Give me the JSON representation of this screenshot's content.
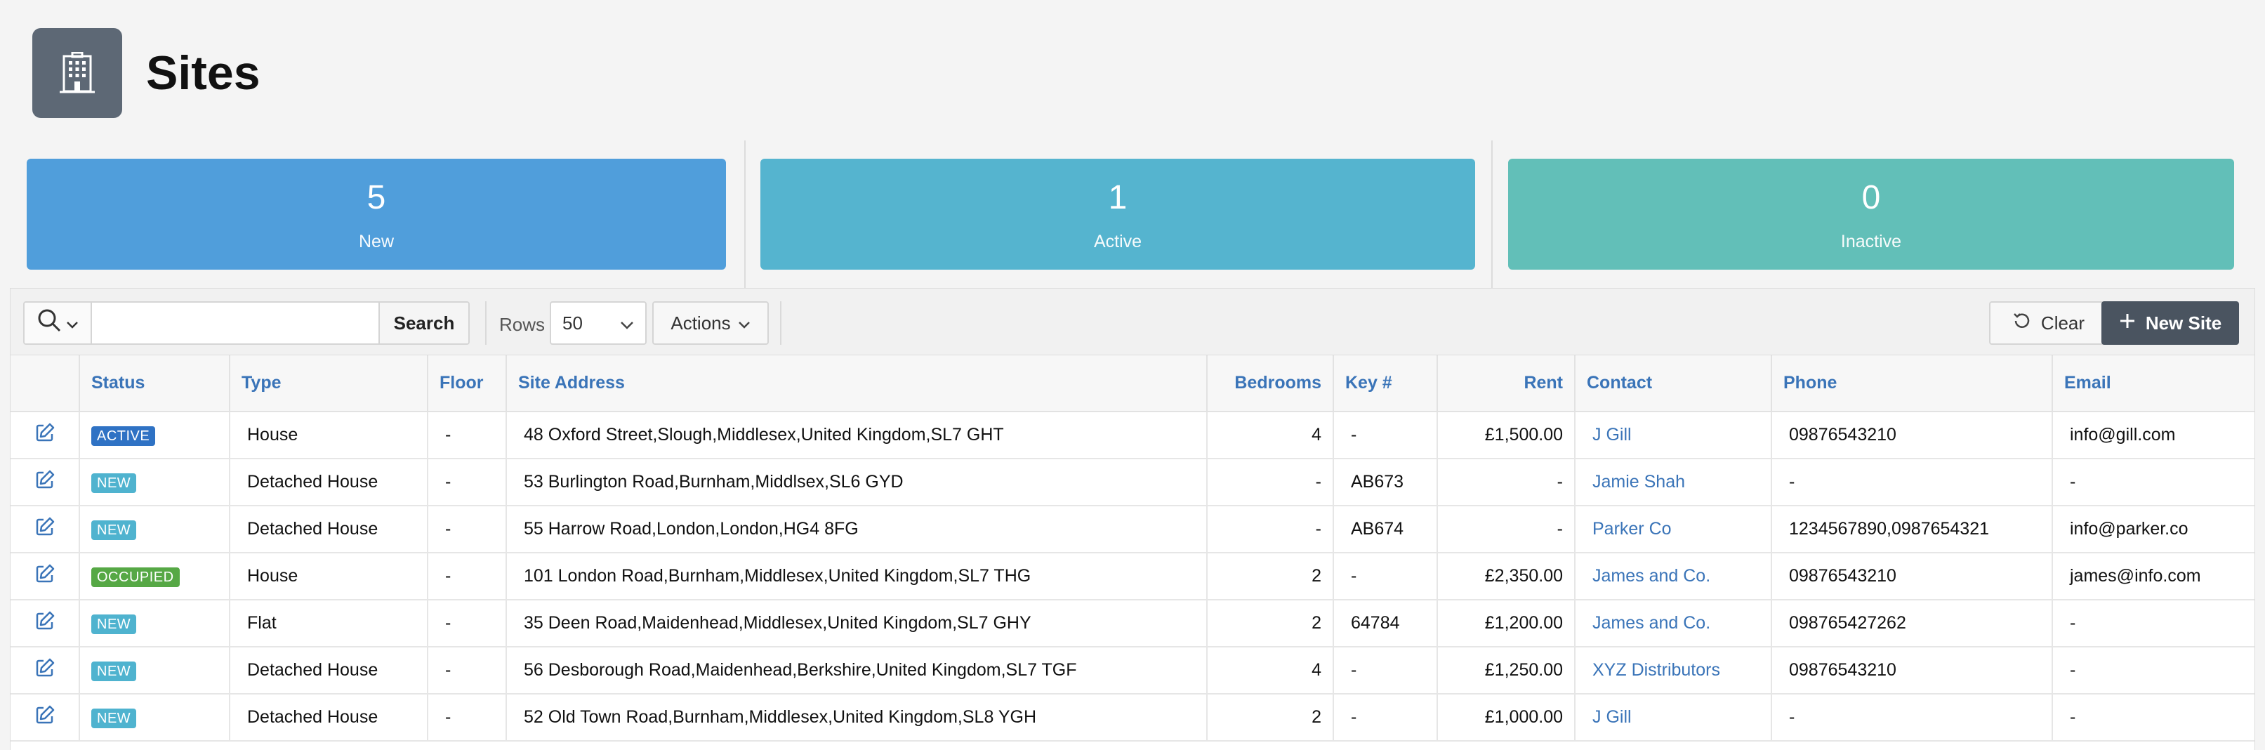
{
  "page": {
    "title": "Sites",
    "icon": "building-icon"
  },
  "stats": [
    {
      "value": "5",
      "label": "New",
      "color": "#509edb"
    },
    {
      "value": "1",
      "label": "Active",
      "color": "#55b4cf"
    },
    {
      "value": "0",
      "label": "Inactive",
      "color": "#62bfb8"
    }
  ],
  "toolbar": {
    "search_value": "",
    "search_label": "Search",
    "rows_label": "Rows",
    "rows_value": "50",
    "actions_label": "Actions",
    "clear_label": "Clear",
    "new_label": "New Site"
  },
  "table": {
    "headers": {
      "status": "Status",
      "type": "Type",
      "floor": "Floor",
      "address": "Site Address",
      "bedrooms": "Bedrooms",
      "key": "Key #",
      "rent": "Rent",
      "contact": "Contact",
      "phone": "Phone",
      "email": "Email"
    },
    "status_colors": {
      "ACTIVE": "#2f72c4",
      "NEW": "#4fb3cf",
      "OCCUPIED": "#56a845"
    },
    "rows": [
      {
        "status": "ACTIVE",
        "type": "House",
        "floor": "-",
        "address": "48 Oxford Street,Slough,Middlesex,United Kingdom,SL7 GHT",
        "bedrooms": "4",
        "key": "-",
        "rent": "£1,500.00",
        "contact": "J Gill",
        "phone": "09876543210",
        "email": "info@gill.com"
      },
      {
        "status": "NEW",
        "type": "Detached House",
        "floor": "-",
        "address": "53 Burlington Road,Burnham,Middlsex,SL6 GYD",
        "bedrooms": "-",
        "key": "AB673",
        "rent": "-",
        "contact": "Jamie Shah",
        "phone": "-",
        "email": "-"
      },
      {
        "status": "NEW",
        "type": "Detached House",
        "floor": "-",
        "address": "55 Harrow Road,London,London,HG4 8FG",
        "bedrooms": "-",
        "key": "AB674",
        "rent": "-",
        "contact": "Parker Co",
        "phone": "1234567890,0987654321",
        "email": "info@parker.co"
      },
      {
        "status": "OCCUPIED",
        "type": "House",
        "floor": "-",
        "address": "101 London Road,Burnham,Middlesex,United Kingdom,SL7 THG",
        "bedrooms": "2",
        "key": "-",
        "rent": "£2,350.00",
        "contact": "James and Co.",
        "phone": "09876543210",
        "email": "james@info.com"
      },
      {
        "status": "NEW",
        "type": "Flat",
        "floor": "-",
        "address": "35 Deen Road,Maidenhead,Middlesex,United Kingdom,SL7 GHY",
        "bedrooms": "2",
        "key": "64784",
        "rent": "£1,200.00",
        "contact": "James and Co.",
        "phone": "098765427262",
        "email": "-"
      },
      {
        "status": "NEW",
        "type": "Detached House",
        "floor": "-",
        "address": "56 Desborough Road,Maidenhead,Berkshire,United Kingdom,SL7 TGF",
        "bedrooms": "4",
        "key": "-",
        "rent": "£1,250.00",
        "contact": "XYZ Distributors",
        "phone": "09876543210",
        "email": "-"
      },
      {
        "status": "NEW",
        "type": "Detached House",
        "floor": "-",
        "address": "52 Old Town Road,Burnham,Middlesex,United Kingdom,SL8 YGH",
        "bedrooms": "2",
        "key": "-",
        "rent": "£1,000.00",
        "contact": "J Gill",
        "phone": "-",
        "email": "-"
      }
    ]
  }
}
